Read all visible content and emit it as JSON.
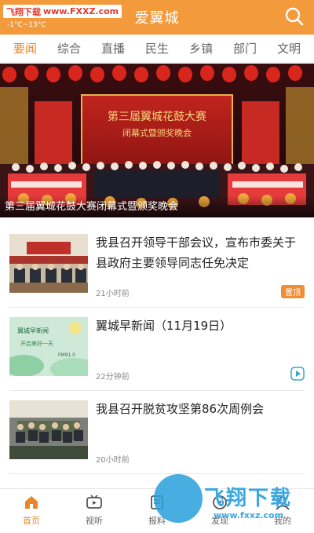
{
  "header": {
    "watermark_badge_left": "飞翔下载",
    "watermark_badge_right": "www.FXXZ.com",
    "weather": "-1°C~13°C",
    "title": "爱翼城",
    "search_icon": "search-icon"
  },
  "tabs": [
    {
      "label": "要闻",
      "active": true
    },
    {
      "label": "综合"
    },
    {
      "label": "直播"
    },
    {
      "label": "民生"
    },
    {
      "label": "乡镇"
    },
    {
      "label": "部门"
    },
    {
      "label": "文明"
    }
  ],
  "banner": {
    "caption": "第三届翼城花鼓大赛闭幕式暨颁奖晚会",
    "screen_title": "第三届翼城花鼓大赛",
    "screen_subtitle": "闭幕式暨颁奖晚会"
  },
  "news": [
    {
      "title": "我县召开领导干部会议，宣布市委关于县政府主要领导同志任免决定",
      "time": "21小时前",
      "tag": "置顶",
      "thumb": "meeting-photo"
    },
    {
      "title": "翼城早新闻（11月19日）",
      "time": "22分钟前",
      "thumb_title": "翼城早新闻",
      "thumb_sub": "开启美好一天",
      "thumb_fm": "FM91.0",
      "icon": "play-icon"
    },
    {
      "title": "我县召开脱贫攻坚第86次周例会",
      "time": "20小时前",
      "thumb": "conference-photo"
    }
  ],
  "bottom_nav": [
    {
      "label": "首页",
      "icon": "home-icon",
      "active": true
    },
    {
      "label": "视听",
      "icon": "tv-icon"
    },
    {
      "label": "报料",
      "icon": "report-icon"
    },
    {
      "label": "发现",
      "icon": "discover-icon"
    },
    {
      "label": "我的",
      "icon": "user-icon"
    }
  ],
  "watermark": {
    "big_text": "飞翔下载",
    "url": "www.fxxz.com"
  },
  "colors": {
    "brand": "#f39b3c",
    "accent": "#e9862a",
    "tag": "#f08d38",
    "play": "#3aa7c8"
  }
}
